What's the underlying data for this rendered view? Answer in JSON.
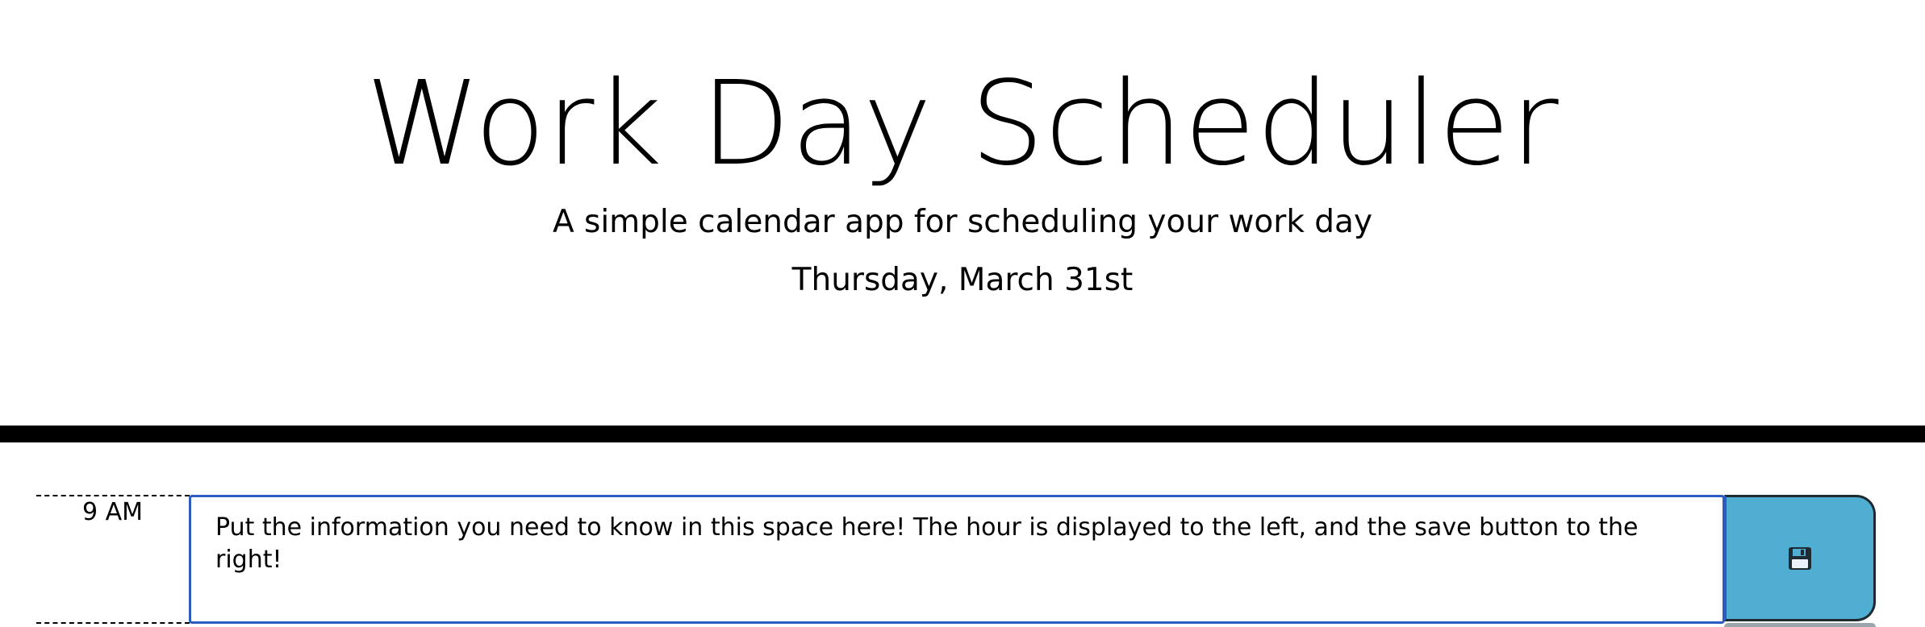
{
  "header": {
    "title": "Work Day Scheduler",
    "subtitle": "A simple calendar app for scheduling your work day",
    "current_date": "Thursday, March 31st"
  },
  "schedule": {
    "rows": [
      {
        "hour_label": "9 AM",
        "task_text": "Put the information you need to know in this space here! The hour is displayed to the left, and the save button to the right!",
        "save_icon": "floppy-disk-icon"
      }
    ]
  },
  "colors": {
    "save_button": "#51aed3",
    "input_border": "#2b5cc4",
    "divider": "#000000"
  }
}
